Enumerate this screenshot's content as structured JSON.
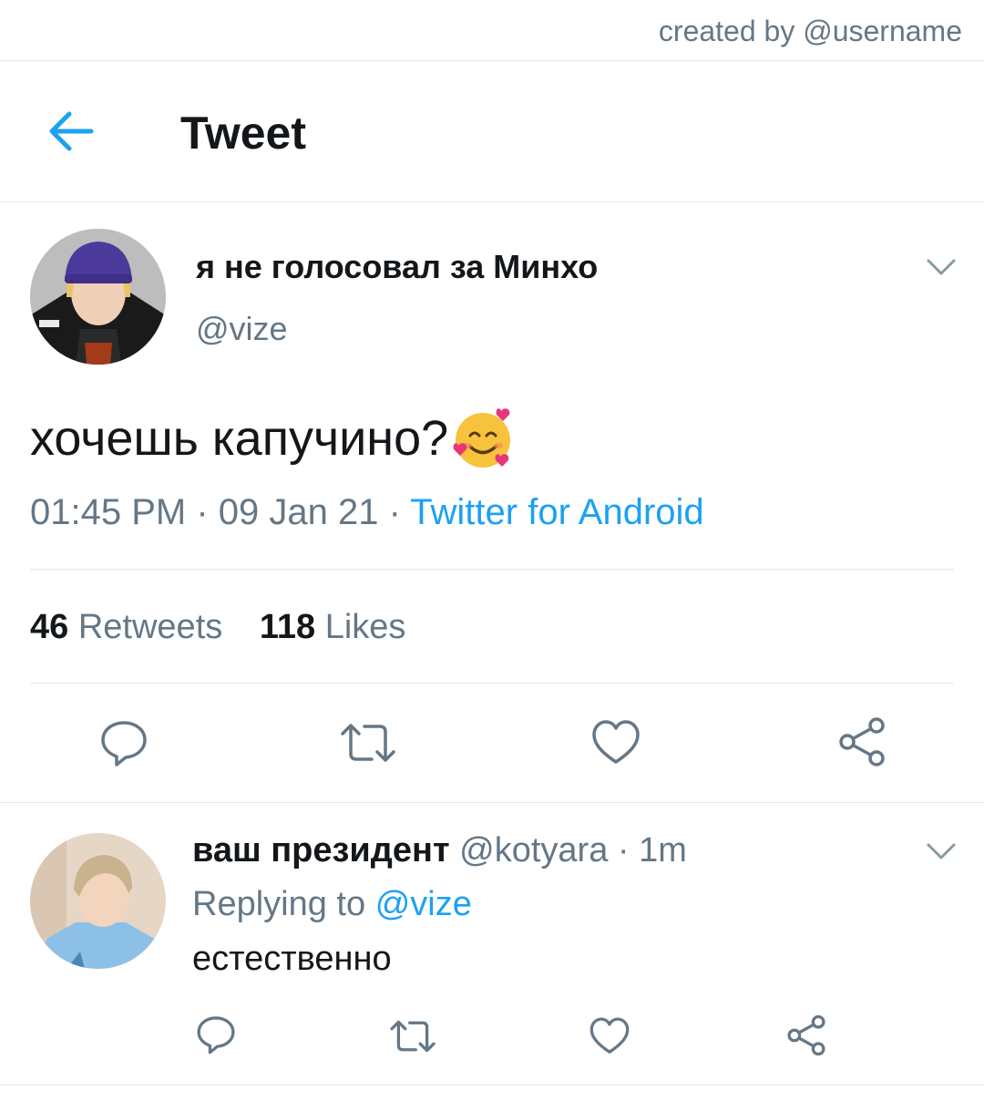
{
  "credit": "created by @username",
  "header": {
    "title": "Tweet"
  },
  "tweet": {
    "display_name": "я не голосовал за Минхо",
    "handle": "@vize",
    "text": "хочешь капучино?",
    "emoji": "smiling-face-with-hearts",
    "time": "01:45 PM",
    "sep1": " · ",
    "date": "09 Jan 21",
    "sep2": " · ",
    "source": "Twitter for Android",
    "retweets_count": "46",
    "retweets_label": "Retweets",
    "likes_count": "118",
    "likes_label": "Likes"
  },
  "reply": {
    "display_name": "ваш президент",
    "handle": "@kotyara",
    "sep": " · ",
    "time": "1m",
    "replying_label": "Replying to",
    "replying_to": "@vize",
    "text": "естественно"
  },
  "icons": [
    "arrow-left",
    "chevron-down",
    "reply",
    "retweet",
    "like",
    "share"
  ],
  "colors": {
    "accent": "#1da1f2",
    "secondary_text": "#657786",
    "divider": "#e1e8ed"
  }
}
